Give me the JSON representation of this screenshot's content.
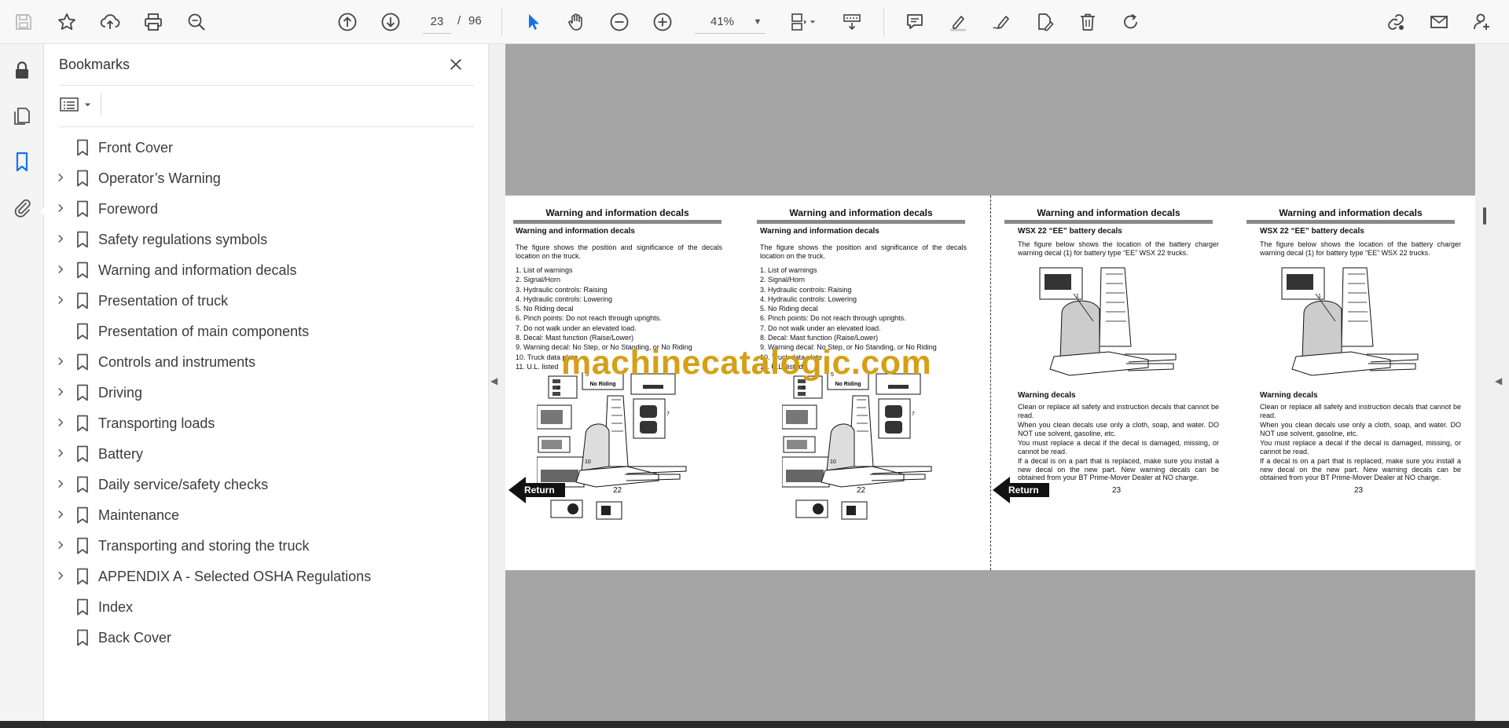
{
  "toolbar": {
    "current_page": "23",
    "page_separator": "/",
    "total_pages": "96",
    "zoom": "41%"
  },
  "bookmarks": {
    "title": "Bookmarks",
    "items": [
      {
        "label": "Front Cover",
        "expandable": false
      },
      {
        "label": "Operator’s Warning",
        "expandable": true
      },
      {
        "label": "Foreword",
        "expandable": true
      },
      {
        "label": "Safety regulations symbols",
        "expandable": true
      },
      {
        "label": "Warning and information decals",
        "expandable": true
      },
      {
        "label": "Presentation of truck",
        "expandable": true
      },
      {
        "label": "Presentation of main components",
        "expandable": false
      },
      {
        "label": "Controls and instruments",
        "expandable": true
      },
      {
        "label": "Driving",
        "expandable": true
      },
      {
        "label": "Transporting loads",
        "expandable": true
      },
      {
        "label": "Battery",
        "expandable": true
      },
      {
        "label": "Daily service/safety checks",
        "expandable": true
      },
      {
        "label": "Maintenance",
        "expandable": true
      },
      {
        "label": "Transporting and storing the truck",
        "expandable": true
      },
      {
        "label": "APPENDIX A - Selected OSHA Regulations",
        "expandable": true
      },
      {
        "label": "Index",
        "expandable": false
      },
      {
        "label": "Back Cover",
        "expandable": false
      }
    ]
  },
  "document": {
    "page22": {
      "header": "Warning and information decals",
      "subheading": "Warning and information decals",
      "intro": "The figure shows the position and significance of the decals location on the truck.",
      "list": [
        "1.  List of warnings",
        "2.  Signal/Horn",
        "3.  Hydraulic controls: Raising",
        "4.  Hydraulic controls: Lowering",
        "5.  No Riding decal",
        "6.  Pinch points: Do not reach through uprights.",
        "7.  Do not walk under an elevated load.",
        "8.  Decal: Mast function (Raise/Lower)",
        "9.  Warning decal: No Step, or No Standing, or No Riding",
        "10. Truck data plate",
        "11. U.L. listed"
      ],
      "figure_label": "No Riding",
      "page_number": "22",
      "return_label": "Return"
    },
    "page23": {
      "header": "Warning and information decals",
      "subheading": "WSX 22 “EE” battery decals",
      "intro": "The figure below shows the location of the battery charger warning decal (1) for battery type “EE” WSX 22 trucks.",
      "section": "Warning decals",
      "paragraphs": [
        "Clean or replace all safety and instruction decals that cannot be read.",
        "When you clean decals use only a cloth, soap, and water. DO NOT use solvent, gasoline, etc.",
        "You must replace a decal if the decal is damaged, missing, or cannot be read.",
        "If a decal is on a part that is replaced, make sure you install a new decal on the new part. New warning decals can be obtained from your BT Prime-Mover Dealer at NO charge."
      ],
      "page_number": "23",
      "return_label": "Return"
    },
    "watermark": "machinecatalogic.com"
  },
  "colors": {
    "accent": "#1473e6",
    "watermark": "#d4a017",
    "canvas": "#a5a5a5"
  }
}
